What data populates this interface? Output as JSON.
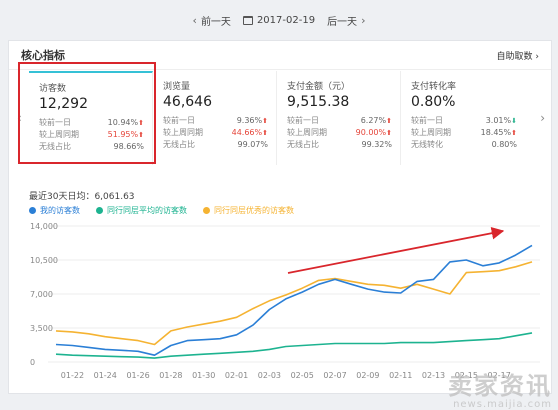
{
  "datebar": {
    "prev": "前一天",
    "date": "2017-02-19",
    "next": "后一天"
  },
  "card": {
    "title": "核心指标",
    "custom_link": "自助取数"
  },
  "metrics": [
    {
      "name": "访客数",
      "value": "12,292",
      "rows": [
        {
          "label": "较前一日",
          "pct": "10.94%",
          "dir": "up",
          "red": false
        },
        {
          "label": "较上周同期",
          "pct": "51.95%",
          "dir": "up",
          "red": true
        },
        {
          "label": "无线占比",
          "pct": "98.66%",
          "dir": "",
          "red": false
        }
      ]
    },
    {
      "name": "浏览量",
      "value": "46,646",
      "rows": [
        {
          "label": "较前一日",
          "pct": "9.36%",
          "dir": "up",
          "red": false
        },
        {
          "label": "较上周同期",
          "pct": "44.66%",
          "dir": "up",
          "red": true
        },
        {
          "label": "无线占比",
          "pct": "99.07%",
          "dir": "",
          "red": false
        }
      ]
    },
    {
      "name": "支付金额（元）",
      "value": "9,515.38",
      "rows": [
        {
          "label": "较前一日",
          "pct": "6.27%",
          "dir": "up",
          "red": false
        },
        {
          "label": "较上周同期",
          "pct": "90.00%",
          "dir": "up",
          "red": true
        },
        {
          "label": "无线占比",
          "pct": "99.32%",
          "dir": "",
          "red": false
        }
      ]
    },
    {
      "name": "支付转化率",
      "value": "0.80%",
      "rows": [
        {
          "label": "较前一日",
          "pct": "3.01%",
          "dir": "down",
          "red": false
        },
        {
          "label": "较上周同期",
          "pct": "18.45%",
          "dir": "up",
          "red": false
        },
        {
          "label": "无线转化",
          "pct": "0.80%",
          "dir": "",
          "red": false
        }
      ]
    }
  ],
  "colors": {
    "mine": "#2b7fd6",
    "peer_avg": "#1db390",
    "peer_best": "#f5b332",
    "highlight": "#d9262c",
    "trend_arrow": "#d9262c"
  },
  "watermark": {
    "main": "卖家资讯",
    "sub": "news.maijia.com"
  },
  "chart_data": {
    "type": "line",
    "subtitle": "最近30天日均：6,061.63",
    "categories": [
      "01-21",
      "01-22",
      "01-23",
      "01-24",
      "01-25",
      "01-26",
      "01-27",
      "01-28",
      "01-29",
      "01-30",
      "01-31",
      "02-01",
      "02-02",
      "02-03",
      "02-04",
      "02-05",
      "02-06",
      "02-07",
      "02-08",
      "02-09",
      "02-10",
      "02-11",
      "02-12",
      "02-13",
      "02-14",
      "02-15",
      "02-16",
      "02-17",
      "02-18",
      "02-19"
    ],
    "tick_labels": [
      "01-22",
      "01-24",
      "01-26",
      "01-28",
      "01-30",
      "02-01",
      "02-03",
      "02-05",
      "02-07",
      "02-09",
      "02-11",
      "02-13",
      "02-15",
      "02-17"
    ],
    "y_ticks": [
      "14,000",
      "10,500",
      "7,000",
      "3,500",
      "0"
    ],
    "ylim": [
      0,
      14000
    ],
    "grid": true,
    "series": [
      {
        "name": "我的访客数",
        "color_key": "mine",
        "values": [
          1800,
          1700,
          1500,
          1300,
          1200,
          1100,
          700,
          1700,
          2200,
          2300,
          2400,
          2800,
          3800,
          5400,
          6500,
          7200,
          8000,
          8500,
          8000,
          7500,
          7200,
          7100,
          8300,
          8500,
          10300,
          10500,
          9900,
          10200,
          11000,
          12000
        ]
      },
      {
        "name": "同行同层平均的访客数",
        "color_key": "peer_avg",
        "values": [
          800,
          700,
          650,
          600,
          550,
          500,
          400,
          600,
          700,
          800,
          900,
          1000,
          1100,
          1300,
          1600,
          1700,
          1800,
          1900,
          1900,
          1900,
          1900,
          2000,
          2000,
          2000,
          2100,
          2200,
          2300,
          2400,
          2700,
          3000
        ]
      },
      {
        "name": "同行同层优秀的访客数",
        "color_key": "peer_best",
        "values": [
          3200,
          3100,
          2900,
          2600,
          2400,
          2200,
          1800,
          3200,
          3600,
          3900,
          4200,
          4600,
          5500,
          6300,
          6900,
          7600,
          8400,
          8600,
          8300,
          8000,
          7900,
          7600,
          8000,
          7500,
          7000,
          9200,
          9300,
          9400,
          9800,
          10300
        ]
      }
    ]
  }
}
